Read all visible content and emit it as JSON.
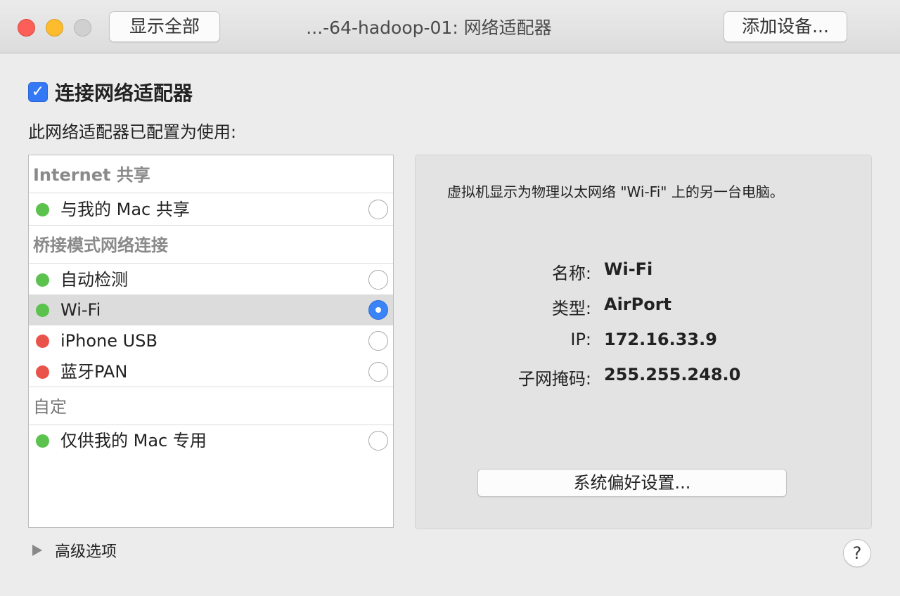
{
  "window": {
    "title": "...-64-hadoop-01: 网络适配器",
    "show_all_label": "显示全部",
    "add_device_label": "添加设备..."
  },
  "connect": {
    "checked": true,
    "check_glyph": "✓",
    "label": "连接网络适配器"
  },
  "configured_label": "此网络适配器已配置为使用:",
  "adapter_list": {
    "sections": [
      {
        "header": "Internet 共享",
        "items": [
          {
            "label": "与我的 Mac 共享",
            "status": "green",
            "selected": false
          }
        ]
      },
      {
        "header": "桥接模式网络连接",
        "items": [
          {
            "label": "自动检测",
            "status": "green",
            "selected": false
          },
          {
            "label": "Wi-Fi",
            "status": "green",
            "selected": true
          },
          {
            "label": "iPhone USB",
            "status": "red",
            "selected": false
          },
          {
            "label": "蓝牙PAN",
            "status": "red",
            "selected": false
          }
        ]
      },
      {
        "header": "自定",
        "items": [
          {
            "label": "仅供我的 Mac 专用",
            "status": "green",
            "selected": false
          }
        ]
      }
    ]
  },
  "info": {
    "description": "虚拟机显示为物理以太网络 \"Wi-Fi\" 上的另一台电脑。",
    "name_label": "名称:",
    "name_value": "Wi-Fi",
    "type_label": "类型:",
    "type_value": "AirPort",
    "ip_label": "IP:",
    "ip_value": "172.16.33.9",
    "subnet_label": "子网掩码:",
    "subnet_value": "255.255.248.0",
    "prefs_button_label": "系统偏好设置..."
  },
  "advanced_label": "高级选项",
  "help_label": "?",
  "colors": {
    "status_green": "#5ac24d",
    "status_red": "#e9534a",
    "accent_blue": "#3478f6"
  }
}
